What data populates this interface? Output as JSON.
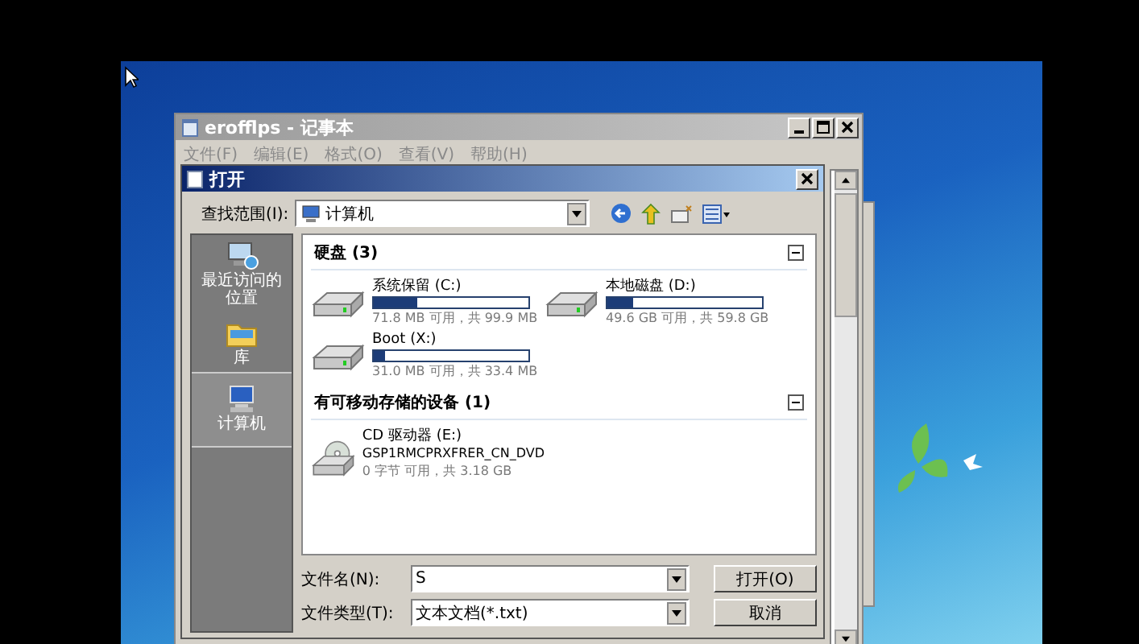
{
  "notepad": {
    "title": "erofflps - 记事本",
    "menu": [
      {
        "label": "文件(F)"
      },
      {
        "label": "编辑(E)"
      },
      {
        "label": "格式(O)"
      },
      {
        "label": "查看(V)"
      },
      {
        "label": "帮助(H)"
      }
    ]
  },
  "dialog": {
    "title": "打开",
    "look_in_label": "查找范围(I):",
    "look_in_value": "计算机",
    "places": [
      {
        "label": "最近访问的位置",
        "kind": "recent",
        "selected": false
      },
      {
        "label": "库",
        "kind": "library",
        "selected": false
      },
      {
        "label": "计算机",
        "kind": "computer",
        "selected": true
      }
    ],
    "groups": [
      {
        "title": "硬盘 (3)",
        "expanded": true,
        "items": [
          {
            "kind": "disk",
            "name": "系统保留 (C:)",
            "level": 0.28,
            "info": "71.8 MB 可用，共 99.9 MB"
          },
          {
            "kind": "disk",
            "name": "本地磁盘 (D:)",
            "level": 0.17,
            "info": "49.6 GB 可用，共 59.8 GB"
          },
          {
            "kind": "disk",
            "name": "Boot (X:)",
            "level": 0.07,
            "info": "31.0 MB 可用，共 33.4 MB"
          }
        ]
      },
      {
        "title": "有可移动存储的设备 (1)",
        "expanded": true,
        "items": [
          {
            "kind": "cd",
            "name": "CD 驱动器 (E:)",
            "label": "GSP1RMCPRXFRER_CN_DVD",
            "info": "0 字节 可用，共 3.18 GB"
          }
        ]
      }
    ],
    "filename_label": "文件名(N):",
    "filename_value": "S",
    "filetype_label": "文件类型(T):",
    "filetype_value": "文本文档(*.txt)",
    "open_button": "打开(O)",
    "cancel_button": "取消"
  }
}
